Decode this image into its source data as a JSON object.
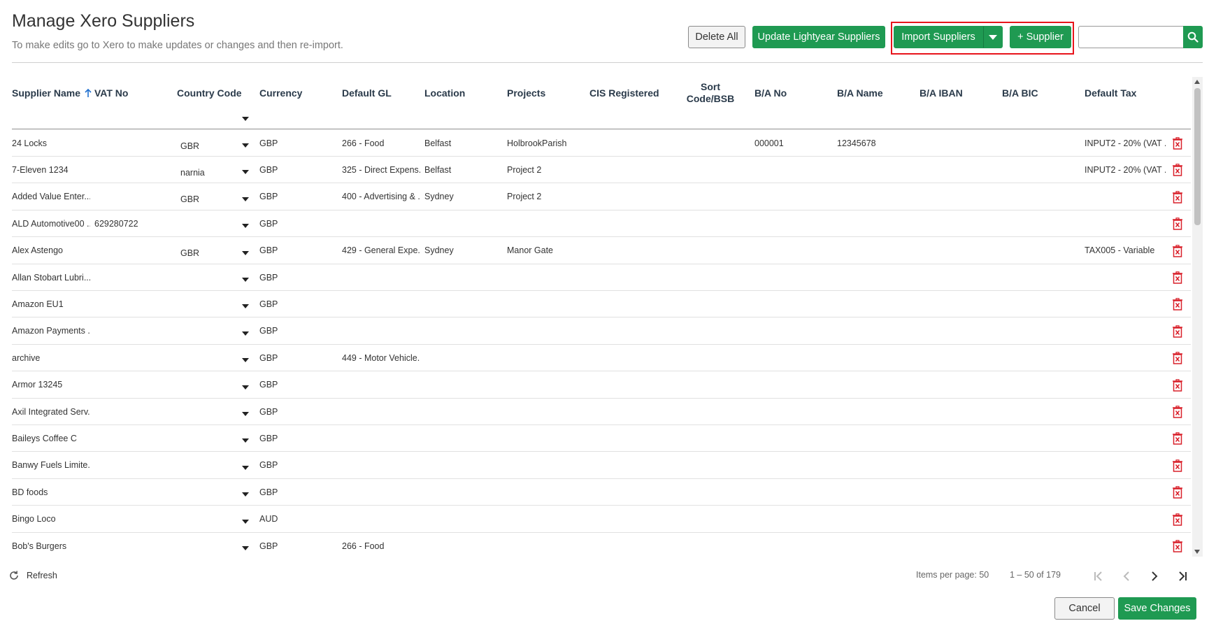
{
  "page": {
    "title": "Manage Xero Suppliers",
    "subtitle": "To make edits go to Xero to make updates or changes and then re-import."
  },
  "toolbar": {
    "delete_all": "Delete All",
    "update_lightyear": "Update Lightyear Suppliers",
    "import_suppliers": "Import Suppliers",
    "add_supplier": "+ Supplier",
    "search_value": ""
  },
  "table": {
    "columns": {
      "supplier_name": "Supplier Name",
      "vat_no": "VAT No",
      "country_code": "Country Code",
      "currency": "Currency",
      "default_gl": "Default GL",
      "location": "Location",
      "projects": "Projects",
      "cis_registered": "CIS Registered",
      "sort_code": "Sort Code/BSB",
      "ba_no": "B/A No",
      "ba_name": "B/A Name",
      "ba_iban": "B/A IBAN",
      "ba_bic": "B/A BIC",
      "default_tax": "Default Tax"
    },
    "rows": [
      {
        "name": "24 Locks",
        "vat": "",
        "country": "GBR",
        "currency": "GBP",
        "gl": "266 - Food",
        "location": "Belfast",
        "projects": "HolbrookParish",
        "ba_no": "000001",
        "ba_name": "12345678",
        "tax": "INPUT2 - 20% (VAT ..."
      },
      {
        "name": "7-Eleven 1234",
        "vat": "",
        "country": "narnia",
        "currency": "GBP",
        "gl": "325 - Direct Expens...",
        "location": "Belfast",
        "projects": "Project 2",
        "ba_no": "",
        "ba_name": "",
        "tax": "INPUT2 - 20% (VAT ..."
      },
      {
        "name": "Added Value Enter...",
        "vat": "",
        "country": "GBR",
        "currency": "GBP",
        "gl": "400 - Advertising & ...",
        "location": "Sydney",
        "projects": "Project 2",
        "ba_no": "",
        "ba_name": "",
        "tax": ""
      },
      {
        "name": "ALD Automotive00 ...",
        "vat": "629280722",
        "country": "",
        "currency": "GBP",
        "gl": "",
        "location": "",
        "projects": "",
        "ba_no": "",
        "ba_name": "",
        "tax": ""
      },
      {
        "name": "Alex Astengo",
        "vat": "",
        "country": "GBR",
        "currency": "GBP",
        "gl": "429 - General Expe...",
        "location": "Sydney",
        "projects": "Manor Gate",
        "ba_no": "",
        "ba_name": "",
        "tax": "TAX005 - Variable"
      },
      {
        "name": "Allan Stobart Lubri...",
        "vat": "",
        "country": "",
        "currency": "GBP",
        "gl": "",
        "location": "",
        "projects": "",
        "ba_no": "",
        "ba_name": "",
        "tax": ""
      },
      {
        "name": "Amazon EU1",
        "vat": "",
        "country": "",
        "currency": "GBP",
        "gl": "",
        "location": "",
        "projects": "",
        "ba_no": "",
        "ba_name": "",
        "tax": ""
      },
      {
        "name": "Amazon Payments ...",
        "vat": "",
        "country": "",
        "currency": "GBP",
        "gl": "",
        "location": "",
        "projects": "",
        "ba_no": "",
        "ba_name": "",
        "tax": ""
      },
      {
        "name": "archive",
        "vat": "",
        "country": "",
        "currency": "GBP",
        "gl": "449 - Motor Vehicle...",
        "location": "",
        "projects": "",
        "ba_no": "",
        "ba_name": "",
        "tax": ""
      },
      {
        "name": "Armor 13245",
        "vat": "",
        "country": "",
        "currency": "GBP",
        "gl": "",
        "location": "",
        "projects": "",
        "ba_no": "",
        "ba_name": "",
        "tax": ""
      },
      {
        "name": "Axil Integrated Serv...",
        "vat": "",
        "country": "",
        "currency": "GBP",
        "gl": "",
        "location": "",
        "projects": "",
        "ba_no": "",
        "ba_name": "",
        "tax": ""
      },
      {
        "name": "Baileys Coffee C",
        "vat": "",
        "country": "",
        "currency": "GBP",
        "gl": "",
        "location": "",
        "projects": "",
        "ba_no": "",
        "ba_name": "",
        "tax": ""
      },
      {
        "name": "Banwy Fuels Limite...",
        "vat": "",
        "country": "",
        "currency": "GBP",
        "gl": "",
        "location": "",
        "projects": "",
        "ba_no": "",
        "ba_name": "",
        "tax": ""
      },
      {
        "name": "BD foods",
        "vat": "",
        "country": "",
        "currency": "GBP",
        "gl": "",
        "location": "",
        "projects": "",
        "ba_no": "",
        "ba_name": "",
        "tax": ""
      },
      {
        "name": "Bingo Loco",
        "vat": "",
        "country": "",
        "currency": "AUD",
        "gl": "",
        "location": "",
        "projects": "",
        "ba_no": "",
        "ba_name": "",
        "tax": ""
      },
      {
        "name": "Bob's Burgers",
        "vat": "",
        "country": "",
        "currency": "GBP",
        "gl": "266 - Food",
        "location": "",
        "projects": "",
        "ba_no": "",
        "ba_name": "",
        "tax": ""
      }
    ]
  },
  "footer": {
    "refresh": "Refresh",
    "items_per_page": "Items per page: 50",
    "range": "1 – 50 of 179",
    "cancel": "Cancel",
    "save": "Save Changes"
  },
  "colors": {
    "primary_green": "#1f9a52",
    "highlight_red": "#e8141b",
    "delete_red": "#d9202a"
  }
}
